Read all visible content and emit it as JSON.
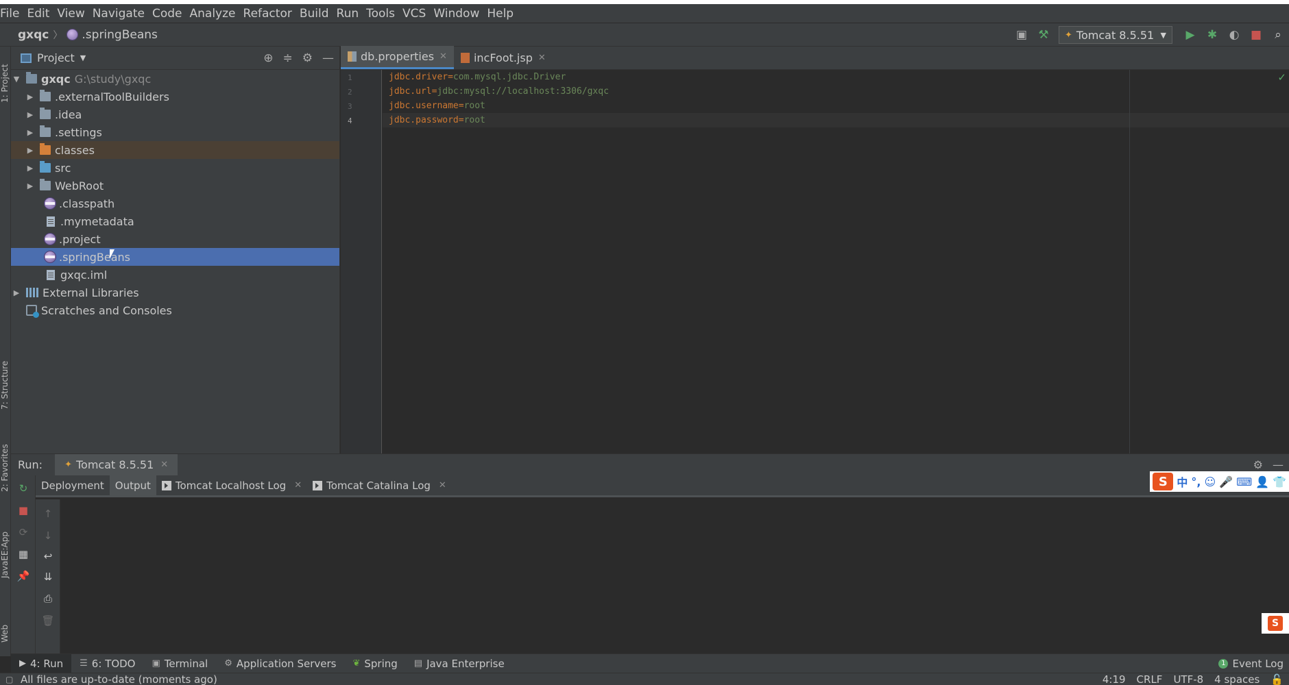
{
  "menubar": {
    "items": [
      "File",
      "Edit",
      "View",
      "Navigate",
      "Code",
      "Analyze",
      "Refactor",
      "Build",
      "Run",
      "Tools",
      "VCS",
      "Window",
      "Help"
    ]
  },
  "breadcrumb": {
    "project": "gxqc",
    "file": ".springBeans"
  },
  "toolbar": {
    "run_config": "Tomcat 8.5.51"
  },
  "left_strip": {
    "project": "1: Project",
    "structure": "7: Structure",
    "favorites": "2: Favorites",
    "javaee": "JavaEE:App",
    "web": "Web"
  },
  "project_panel": {
    "title": "Project",
    "root_name": "gxqc",
    "root_path": "G:\\study\\gxqc",
    "items": [
      ".externalToolBuilders",
      ".idea",
      ".settings",
      "classes",
      "src",
      "WebRoot",
      ".classpath",
      ".mymetadata",
      ".project",
      ".springBeans",
      "gxqc.iml"
    ],
    "external_libraries": "External Libraries",
    "scratches": "Scratches and Consoles"
  },
  "editor": {
    "tabs": [
      "db.properties",
      "incFoot.jsp"
    ],
    "lines": [
      {
        "num": "1",
        "key": "jdbc.driver",
        "eq": "=",
        "value": "com.mysql.jdbc.Driver"
      },
      {
        "num": "2",
        "key": "jdbc.url",
        "eq": "=",
        "value": "jdbc:mysql://localhost:3306/gxqc"
      },
      {
        "num": "3",
        "key": "jdbc.username",
        "eq": "=",
        "value": "root"
      },
      {
        "num": "4",
        "key": "jdbc.password",
        "eq": "=",
        "value": "root"
      }
    ]
  },
  "run_panel": {
    "label": "Run:",
    "tab": "Tomcat 8.5.51",
    "subtabs": [
      "Deployment",
      "Output",
      "Tomcat Localhost Log",
      "Tomcat Catalina Log"
    ]
  },
  "ime": {
    "logo": "S",
    "mode": "中"
  },
  "bottom_tools": {
    "run": "4: Run",
    "todo": "6: TODO",
    "terminal": "Terminal",
    "app_servers": "Application Servers",
    "spring": "Spring",
    "java_enterprise": "Java Enterprise",
    "event_log": "Event Log",
    "event_count": "1"
  },
  "statusbar": {
    "message": "All files are up-to-date (moments ago)",
    "position": "4:19",
    "line_sep": "CRLF",
    "encoding": "UTF-8",
    "indent": "4 spaces"
  },
  "colors": {
    "selection": "#4b6eaf",
    "keyword": "#cc7832",
    "string": "#6a8759",
    "background": "#2b2b2b",
    "panel": "#3c3f41"
  }
}
